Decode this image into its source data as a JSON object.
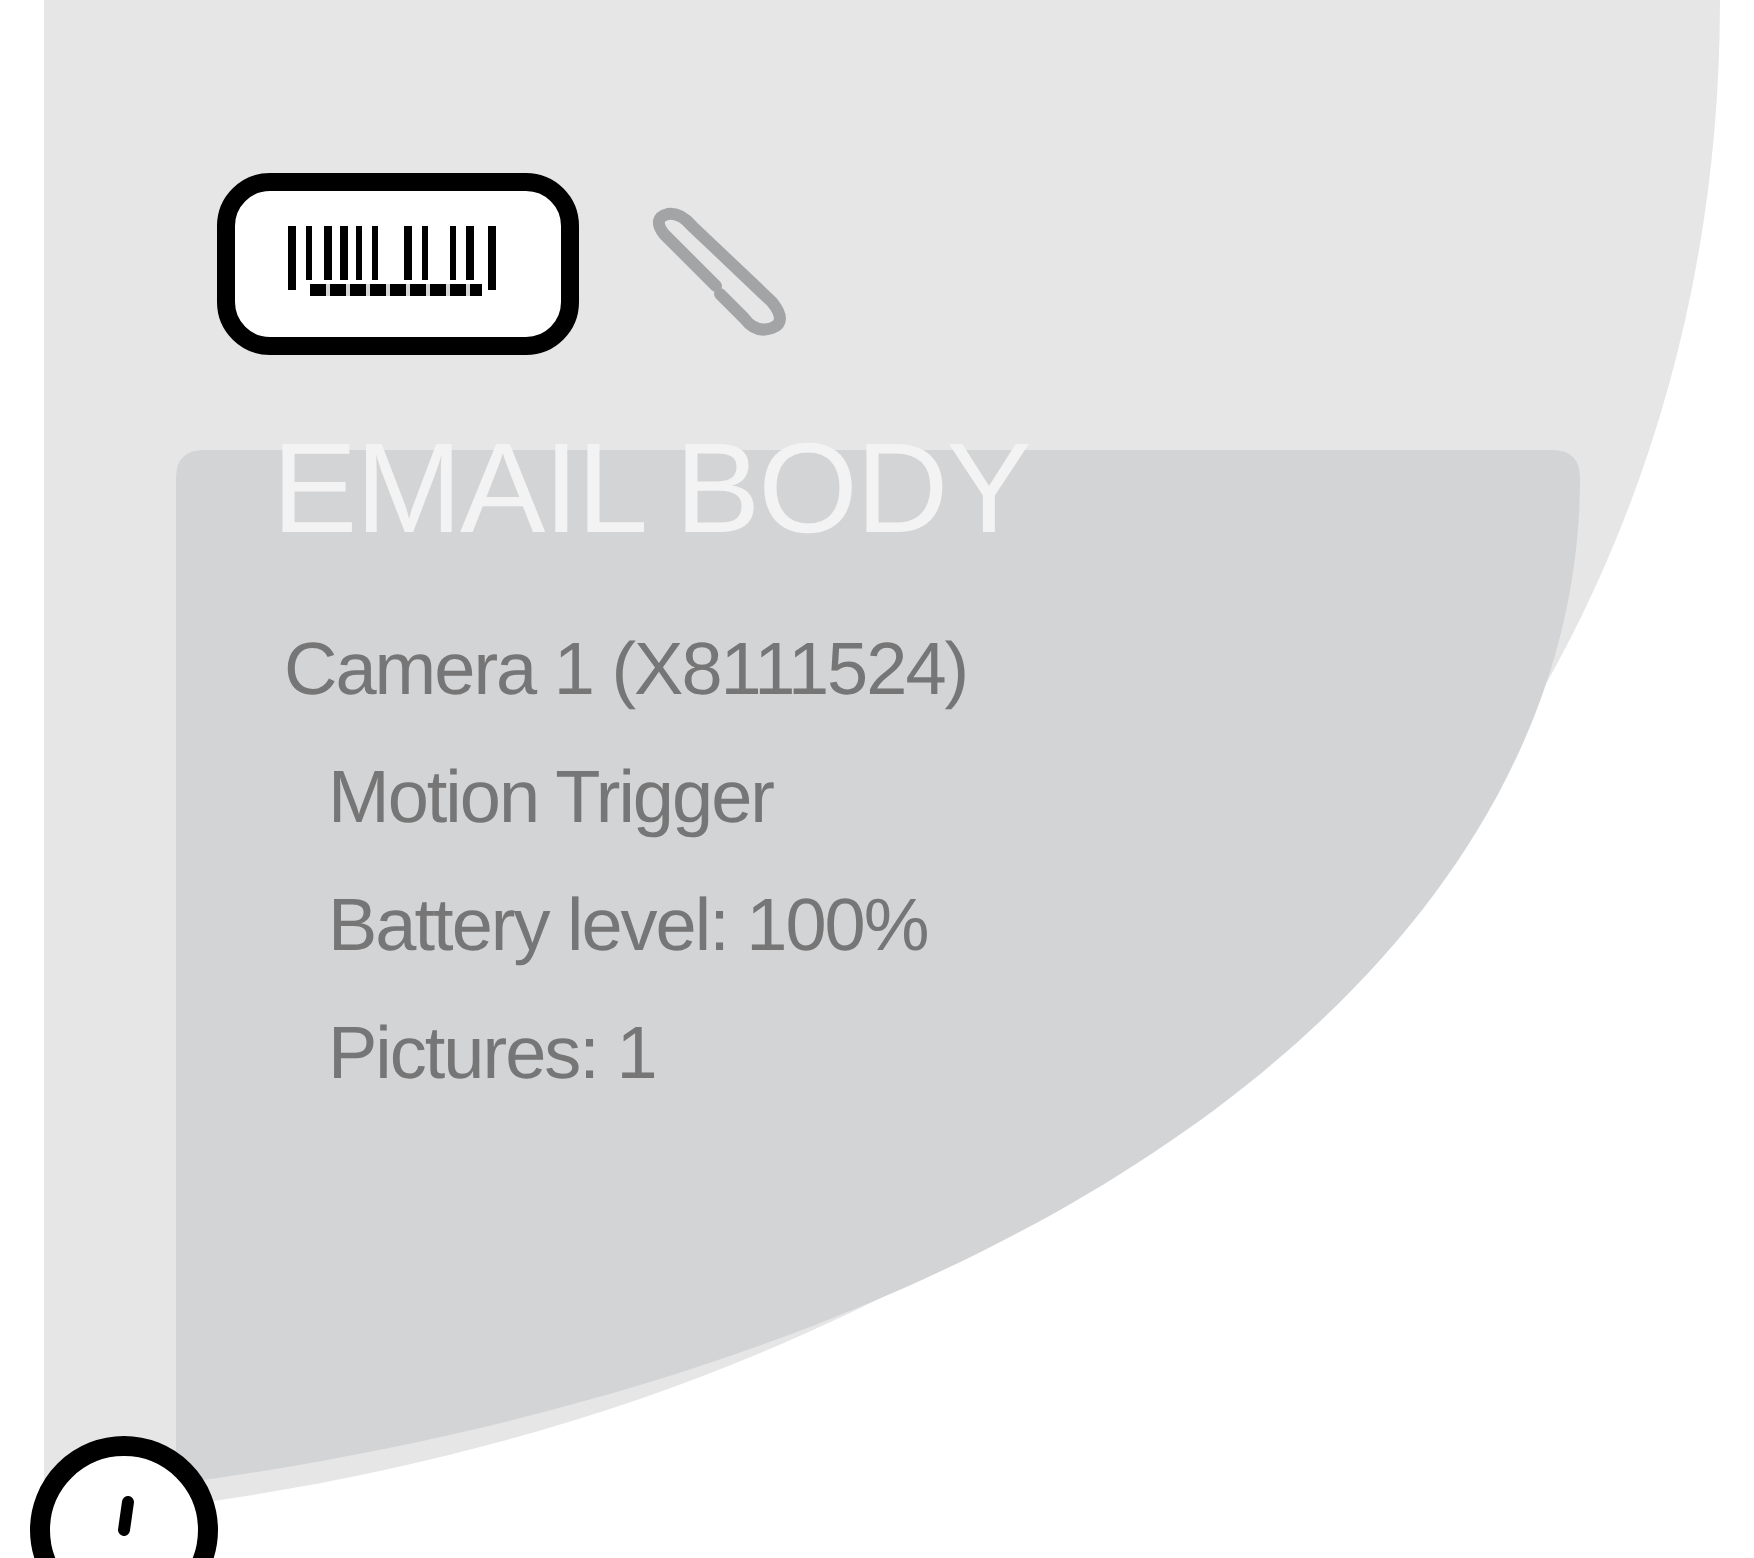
{
  "email_body": {
    "heading": "EMAIL BODY",
    "lines": [
      {
        "text": "Camera 1 (X8111524)",
        "kind": "title"
      },
      {
        "text": "Motion Trigger",
        "kind": "detail"
      },
      {
        "text": "Battery level: 100%",
        "kind": "detail"
      },
      {
        "text": "Pictures: 1",
        "kind": "detail"
      }
    ]
  }
}
